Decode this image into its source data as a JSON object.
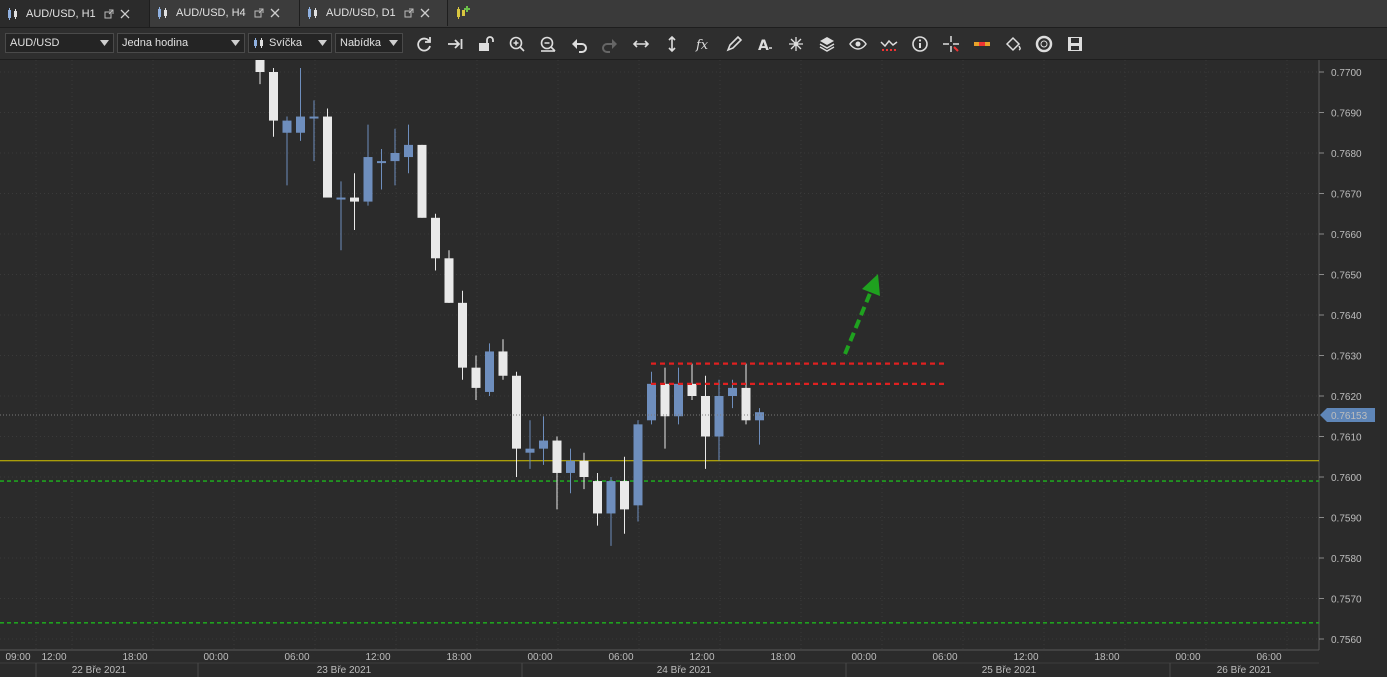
{
  "tabs": [
    {
      "label": "AUD/USD, H1",
      "active": true
    },
    {
      "label": "AUD/USD, H4",
      "active": false
    },
    {
      "label": "AUD/USD, D1",
      "active": false
    }
  ],
  "toolbar": {
    "instrument": "AUD/USD",
    "period": "Jedna hodina",
    "chart_type": "Svíčka",
    "price_side": "Nabídka",
    "icons": [
      "refresh-icon",
      "shift-right-icon",
      "unlock-icon",
      "zoom-in-icon",
      "zoom-out-icon",
      "undo-icon",
      "redo-icon",
      "horizontal-arrows-icon",
      "vertical-arrows-icon",
      "fx-icon",
      "pencil-icon",
      "text-icon",
      "crosshair-star-icon",
      "layers-icon",
      "eye-icon",
      "signal-icon",
      "info-icon",
      "crosshair-icon",
      "ruler-icon",
      "fill-icon",
      "lifebuoy-icon",
      "save-icon"
    ]
  },
  "colors": {
    "background": "#2b2b2b",
    "bull_candle": "#6e8ebd",
    "bear_candle": "#e9e9e9",
    "horizontal_line": "#d4c400",
    "support_lines": "#1fa11f",
    "resistance_lines": "#e02020",
    "arrow": "#1fa11f",
    "price_marker": "#5f86b8"
  },
  "chart_data": {
    "type": "candlestick",
    "instrument": "AUD/USD",
    "timeframe": "H1",
    "ylim": [
      0.7557,
      0.7703
    ],
    "y_ticks": [
      "0.7700",
      "0.7690",
      "0.7680",
      "0.7670",
      "0.7660",
      "0.7650",
      "0.7640",
      "0.7630",
      "0.7620",
      "0.7610",
      "0.7600",
      "0.7590",
      "0.7580",
      "0.7570",
      "0.7560"
    ],
    "x_ticks": [
      "09:00",
      "12:00",
      "18:00",
      "00:00",
      "06:00",
      "12:00",
      "18:00",
      "00:00",
      "06:00",
      "12:00",
      "18:00",
      "00:00",
      "06:00",
      "12:00",
      "18:00",
      "00:00",
      "06:00"
    ],
    "date_labels": [
      "22 Bře 2021",
      "23 Bře 2021",
      "24 Bře 2021",
      "25 Bře 2021",
      "26 Bře 2021"
    ],
    "current_price": "0.76153",
    "candles": [
      {
        "o": 0.7705,
        "h": 0.771,
        "l": 0.7697,
        "c": 0.77
      },
      {
        "o": 0.77,
        "h": 0.7701,
        "l": 0.7684,
        "c": 0.7688
      },
      {
        "o": 0.7685,
        "h": 0.7689,
        "l": 0.7672,
        "c": 0.7688
      },
      {
        "o": 0.7685,
        "h": 0.7701,
        "l": 0.7683,
        "c": 0.7689
      },
      {
        "o": 0.7689,
        "h": 0.7693,
        "l": 0.7678,
        "c": 0.7689
      },
      {
        "o": 0.7689,
        "h": 0.7691,
        "l": 0.7669,
        "c": 0.7669
      },
      {
        "o": 0.7669,
        "h": 0.7673,
        "l": 0.7656,
        "c": 0.7669
      },
      {
        "o": 0.7669,
        "h": 0.7675,
        "l": 0.7661,
        "c": 0.7668
      },
      {
        "o": 0.7668,
        "h": 0.7687,
        "l": 0.7667,
        "c": 0.7679
      },
      {
        "o": 0.7678,
        "h": 0.7681,
        "l": 0.7671,
        "c": 0.7678
      },
      {
        "o": 0.7678,
        "h": 0.7686,
        "l": 0.7672,
        "c": 0.768
      },
      {
        "o": 0.7679,
        "h": 0.7687,
        "l": 0.7675,
        "c": 0.7682
      },
      {
        "o": 0.7682,
        "h": 0.7682,
        "l": 0.7664,
        "c": 0.7664
      },
      {
        "o": 0.7664,
        "h": 0.7665,
        "l": 0.7651,
        "c": 0.7654
      },
      {
        "o": 0.7654,
        "h": 0.7656,
        "l": 0.7643,
        "c": 0.7643
      },
      {
        "o": 0.7643,
        "h": 0.7646,
        "l": 0.7624,
        "c": 0.7627
      },
      {
        "o": 0.7627,
        "h": 0.763,
        "l": 0.7619,
        "c": 0.7622
      },
      {
        "o": 0.7621,
        "h": 0.7633,
        "l": 0.762,
        "c": 0.7631
      },
      {
        "o": 0.7631,
        "h": 0.7634,
        "l": 0.7624,
        "c": 0.7625
      },
      {
        "o": 0.7625,
        "h": 0.7626,
        "l": 0.76,
        "c": 0.7607
      },
      {
        "o": 0.7606,
        "h": 0.7614,
        "l": 0.7602,
        "c": 0.7607
      },
      {
        "o": 0.7607,
        "h": 0.7615,
        "l": 0.7603,
        "c": 0.7609
      },
      {
        "o": 0.7609,
        "h": 0.761,
        "l": 0.7592,
        "c": 0.7601
      },
      {
        "o": 0.7601,
        "h": 0.7607,
        "l": 0.7596,
        "c": 0.7604
      },
      {
        "o": 0.7604,
        "h": 0.7606,
        "l": 0.7597,
        "c": 0.76
      },
      {
        "o": 0.7599,
        "h": 0.7601,
        "l": 0.7588,
        "c": 0.7591
      },
      {
        "o": 0.7591,
        "h": 0.76,
        "l": 0.7583,
        "c": 0.7599
      },
      {
        "o": 0.7599,
        "h": 0.7605,
        "l": 0.7586,
        "c": 0.7592
      },
      {
        "o": 0.7593,
        "h": 0.7614,
        "l": 0.7589,
        "c": 0.7613
      },
      {
        "o": 0.7614,
        "h": 0.7626,
        "l": 0.7613,
        "c": 0.7623
      },
      {
        "o": 0.7623,
        "h": 0.7627,
        "l": 0.7607,
        "c": 0.7615
      },
      {
        "o": 0.7615,
        "h": 0.7627,
        "l": 0.7613,
        "c": 0.7623
      },
      {
        "o": 0.7623,
        "h": 0.7628,
        "l": 0.7619,
        "c": 0.762
      },
      {
        "o": 0.762,
        "h": 0.7625,
        "l": 0.7602,
        "c": 0.761
      },
      {
        "o": 0.761,
        "h": 0.7624,
        "l": 0.7604,
        "c": 0.762
      },
      {
        "o": 0.762,
        "h": 0.7624,
        "l": 0.7617,
        "c": 0.7622
      },
      {
        "o": 0.7622,
        "h": 0.7628,
        "l": 0.7613,
        "c": 0.7614
      },
      {
        "o": 0.7614,
        "h": 0.7617,
        "l": 0.7608,
        "c": 0.7616
      }
    ],
    "horizontal_lines": [
      {
        "price": 0.7604,
        "color": "#d4c400",
        "style": "solid"
      },
      {
        "price": 0.7599,
        "color": "#1fa11f",
        "style": "dashed"
      },
      {
        "price": 0.7564,
        "color": "#1fa11f",
        "style": "dashed"
      }
    ],
    "resistance_segments": [
      {
        "price": 0.7628
      },
      {
        "price": 0.7623
      }
    ],
    "grid": true
  }
}
